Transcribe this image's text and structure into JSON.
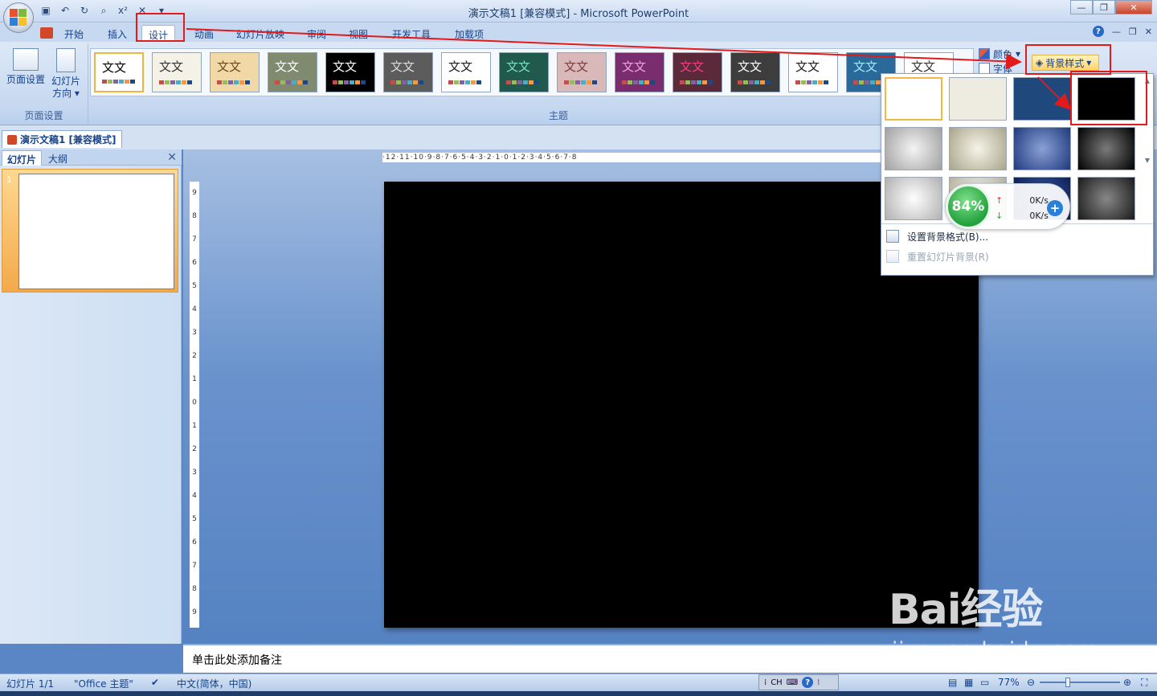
{
  "window": {
    "title": "演示文稿1 [兼容模式] - Microsoft PowerPoint",
    "controls": [
      "minimize",
      "restore",
      "close"
    ]
  },
  "quick_access": [
    "save-icon",
    "undo-icon",
    "redo-icon",
    "print-preview-icon",
    "superscript-icon",
    "close-x-icon",
    "customize-icon"
  ],
  "ribbon_tabs": [
    {
      "label": "开始"
    },
    {
      "label": "插入"
    },
    {
      "label": "设计",
      "active": true
    },
    {
      "label": "动画"
    },
    {
      "label": "幻灯片放映"
    },
    {
      "label": "审阅"
    },
    {
      "label": "视图"
    },
    {
      "label": "开发工具"
    },
    {
      "label": "加载项"
    }
  ],
  "ribbon": {
    "page_setup_group": {
      "label": "页面设置",
      "page_setup_btn": "页面设置",
      "orientation_btn_line1": "幻灯片",
      "orientation_btn_line2": "方向"
    },
    "themes_group": {
      "label": "主题",
      "theme_text": "文文",
      "themes": [
        {
          "bg": "#ffffff",
          "fg": "#000000",
          "selected": true
        },
        {
          "bg": "#f4f1e6",
          "fg": "#333333"
        },
        {
          "bg": "#f1d9a7",
          "fg": "#6b4a16"
        },
        {
          "bg": "#7f8a6e",
          "fg": "#ffffff"
        },
        {
          "bg": "#000000",
          "fg": "#ffffff"
        },
        {
          "bg": "#5c5c5c",
          "fg": "#dddddd"
        },
        {
          "bg": "#ffffff",
          "fg": "#1a1a1a"
        },
        {
          "bg": "#1f5a4c",
          "fg": "#7ee0c0"
        },
        {
          "bg": "#d8b8b8",
          "fg": "#7a3d3d"
        },
        {
          "bg": "#7a2d6e",
          "fg": "#f0a0e0"
        },
        {
          "bg": "#5a2a3a",
          "fg": "#f04080"
        },
        {
          "bg": "#3d3d3d",
          "fg": "#ffffff"
        },
        {
          "bg": "#ffffff",
          "fg": "#1a1a1a"
        },
        {
          "bg": "#2a6a9a",
          "fg": "#a0e8ff"
        },
        {
          "bg": "#ffffff",
          "fg": "#333333"
        }
      ]
    },
    "colors_btn": "颜色",
    "fonts_btn": "字体",
    "background_styles_btn": "背景样式"
  },
  "document_tab": {
    "label": "演示文稿1 [兼容模式]"
  },
  "left_pane": {
    "tabs": [
      {
        "label": "幻灯片",
        "active": true
      },
      {
        "label": "大纲"
      }
    ],
    "slide_number": "1"
  },
  "rulers": {
    "horizontal": "·12·11·10·9·8·7·6·5·4·3·2·1·0·1·2·3·4·5·6·7·8",
    "vertical": [
      "9",
      "8",
      "7",
      "6",
      "5",
      "4",
      "3",
      "2",
      "1",
      "0",
      "1",
      "2",
      "3",
      "4",
      "5",
      "6",
      "7",
      "8",
      "9"
    ]
  },
  "slide": {
    "background": "#000000"
  },
  "notes": {
    "placeholder": "单击此处添加备注"
  },
  "status_bar": {
    "slide_info": "幻灯片 1/1",
    "theme": "\"Office 主题\"",
    "language": "中文(简体，中国)",
    "zoom": "77%",
    "ime": "CH"
  },
  "background_dropdown": {
    "swatches": [
      {
        "fill": "#ffffff",
        "selected": true
      },
      {
        "fill": "#eeece1"
      },
      {
        "fill": "#1f497d"
      },
      {
        "fill": "#000000"
      },
      {
        "fill": "radial-gradient(circle at 50% 50%, #f4f4f4, #a0a0a0)"
      },
      {
        "fill": "radial-gradient(circle at 50% 50%, #f6f4e8, #a8a48c)"
      },
      {
        "fill": "radial-gradient(circle at 50% 50%, #8aa0d6, #1f3a7d)"
      },
      {
        "fill": "radial-gradient(circle at 50% 50%, #7a7a7a, #000000)"
      },
      {
        "fill": "radial-gradient(circle at 50% 50%, #ffffff, #b0b0b0)"
      },
      {
        "fill": "radial-gradient(circle at 50% 50%, #ffffff, #b4b09a)"
      },
      {
        "fill": "radial-gradient(circle at 50% 50%, #3a5fb0, #0e1f55)"
      },
      {
        "fill": "radial-gradient(circle at 50% 50%, #888888, #1a1a1a)"
      }
    ],
    "format_background": "设置背景格式(B)...",
    "reset_background": "重置幻灯片背景(R)"
  },
  "speed_widget": {
    "percent": "84%",
    "upload": "0K/s",
    "download": "0K/s"
  },
  "watermark": {
    "logo": "Bai经验",
    "url": "jingyan.baidu.com"
  },
  "colors": {
    "accent_red": "#e21a1a",
    "ribbon_blue": "#c5d8f0",
    "selected_gold": "#f2b945"
  }
}
